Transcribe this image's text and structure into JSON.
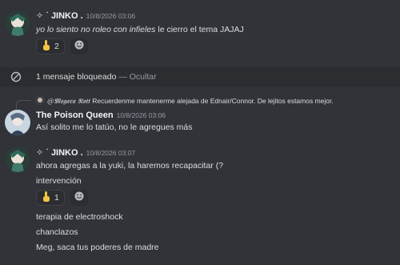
{
  "messages": [
    {
      "author": "JINKO .",
      "author_deco": "✧ ˙",
      "timestamp": "10/8/2026 03:06",
      "text_italic": "yo lo siento no roleo con infieles",
      "text_rest": " le cierro el tema JAJAJ",
      "reaction": {
        "emoji": "point-up-hand-icon",
        "count": "2"
      }
    },
    {
      "author": "The Poison Queen",
      "timestamp": "10/8/2026 03:06",
      "reply_author": "@𝕸𝖊𝖌𝖆𝖗𝖆 𝕹𝖔𝖙𝖙",
      "reply_text": "Recuerdenme mantenerme alejada de Ednair/Connor. De lejitos estamos mejor.",
      "text": "Así solito me lo tatúo, no le agregues más"
    },
    {
      "author": "JINKO .",
      "author_deco": "✧ ˙",
      "timestamp": "10/8/2026 03:07",
      "lines": [
        "ahora agregas a la yuki, la haremos recapacitar (?",
        "intervención"
      ],
      "reaction": {
        "emoji": "point-up-hand-icon",
        "count": "1"
      },
      "followups": [
        "terapia de electroshock",
        "chanclazos",
        "Meg, saca tus poderes de madre"
      ]
    }
  ],
  "blocked": {
    "label": "1 mensaje bloqueado",
    "separator": "—",
    "action": "Ocultar"
  },
  "colors": {
    "background": "#313338",
    "reaction_bg": "#2b2d31",
    "blocked_bg": "#2b2d31",
    "emoji_yellow": "#f5c342"
  }
}
